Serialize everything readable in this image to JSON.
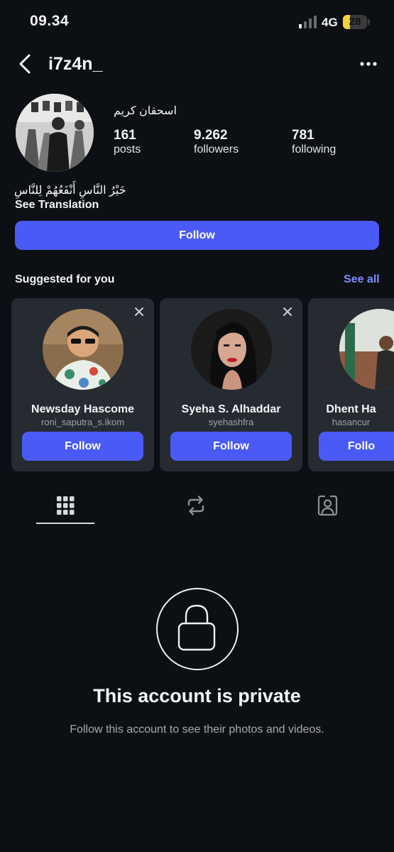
{
  "status_bar": {
    "time": "09.34",
    "network": "4G",
    "battery": 28
  },
  "header": {
    "username": "i7z4n_"
  },
  "profile": {
    "full_name": "اسحقان كريم",
    "stats": [
      {
        "value": "161",
        "label": "posts"
      },
      {
        "value": "9.262",
        "label": "followers"
      },
      {
        "value": "781",
        "label": "following"
      }
    ],
    "bio": "خَيْرُ النَّاسِ أَنْفَعُهُمْ لِلنَّاسِ",
    "see_translation": "See Translation",
    "follow_label": "Follow"
  },
  "suggested": {
    "title": "Suggested for you",
    "see_all": "See all",
    "cards": [
      {
        "name": "Newsday Hascome",
        "handle": "roni_saputra_s.ikom",
        "button": "Follow"
      },
      {
        "name": "Syeha S. Alhaddar",
        "handle": "syehashfra",
        "button": "Follow"
      },
      {
        "name": "Dhent Ha",
        "handle": "hasancur",
        "button": "Follo"
      }
    ]
  },
  "tabs": [
    {
      "icon": "grid-icon",
      "active": true
    },
    {
      "icon": "reposts-icon",
      "active": false
    },
    {
      "icon": "tagged-icon",
      "active": false
    }
  ],
  "private": {
    "title": "This account is private",
    "subtitle": "Follow this account to see their photos and videos."
  },
  "colors": {
    "background": "#0c0f14",
    "accent": "#4a5bf5",
    "link": "#7d8cff",
    "card": "#262a31"
  }
}
